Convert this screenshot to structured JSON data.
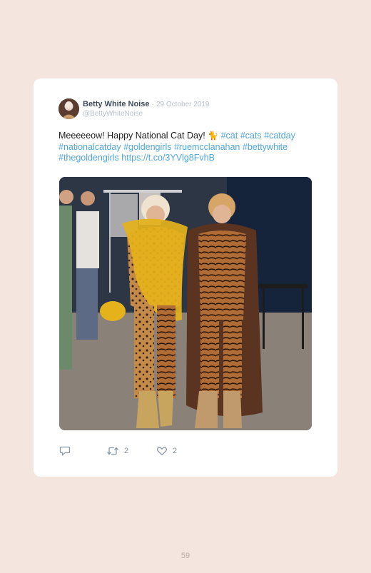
{
  "tweet": {
    "author_name": "Betty White Noise",
    "separator": "·",
    "date": "29 October 2019",
    "handle": "@BettyWhiteNoise",
    "text_parts": {
      "p0": "Meeeeeow! Happy National Cat Day! ",
      "emoji": "🐈",
      "tag1": "#cat",
      "tag2": "#cats",
      "tag3": "#catday",
      "tag4": "#nationalcatday",
      "tag5": "#goldengirls",
      "tag6": "#ruemcclanahan",
      "tag7": "#bettywhite",
      "tag8": "#thegoldengirls",
      "link": "https://t.co/3YVlg8FvhB"
    },
    "photo_icon": "photo-of-two-women-in-leopard-and-tiger-costumes",
    "actions": {
      "reply_icon": "reply-icon",
      "retweet_icon": "retweet-icon",
      "retweet_count": "2",
      "like_icon": "heart-icon",
      "like_count": "2"
    }
  },
  "page_number": "59",
  "colors": {
    "background": "#f4e6df",
    "card": "#ffffff",
    "link": "#4fa7dd",
    "muted": "#b8c1cb",
    "author": "#3f4a58"
  }
}
